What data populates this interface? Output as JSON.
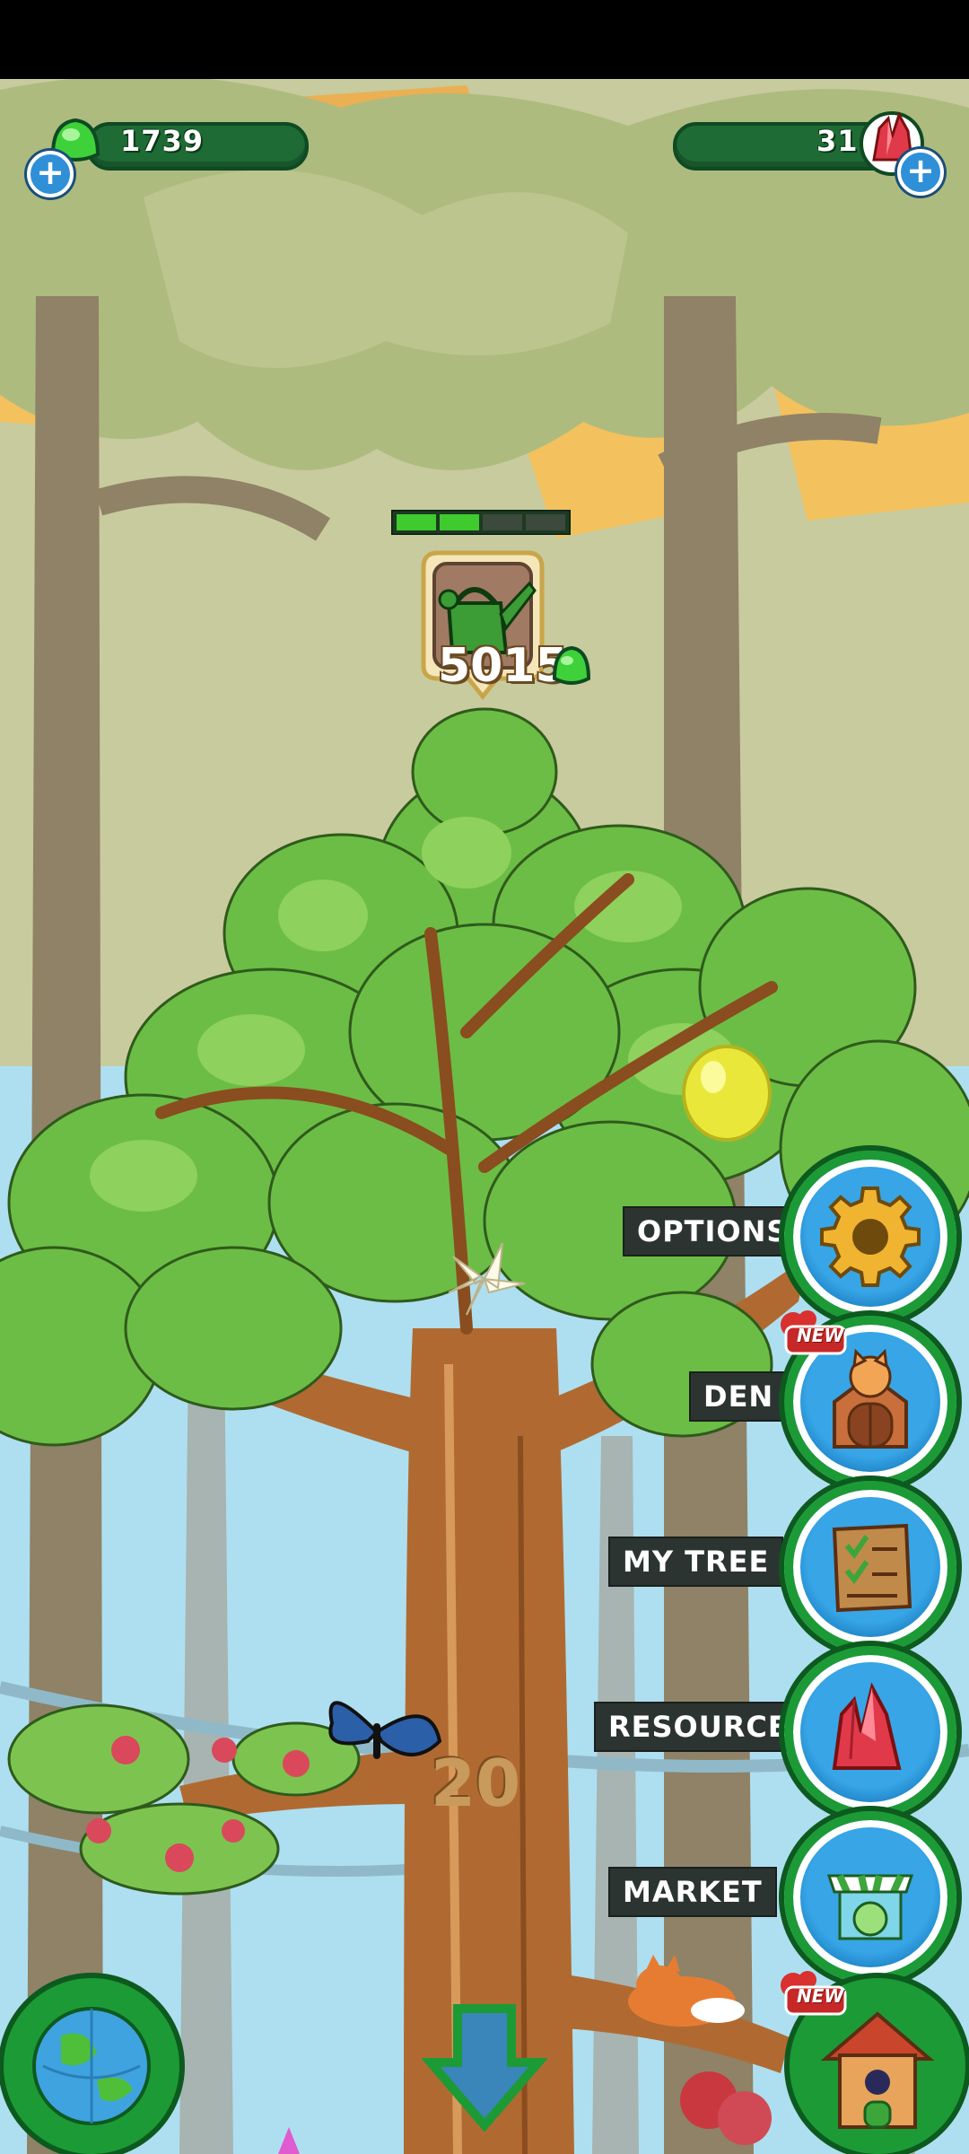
{
  "currencies": {
    "gems_green": "1739",
    "crystals_red": "31",
    "add_symbol": "+"
  },
  "watering": {
    "cost": "5015",
    "progress_segments_filled": 2,
    "progress_segments_total": 4
  },
  "tree": {
    "level": "20"
  },
  "menu": {
    "options": "OPTIONS",
    "den": "DEN",
    "my_tree": "MY TREE",
    "resources": "RESOURCES",
    "market": "MARKET",
    "new_badge": "NEW"
  },
  "icons": {
    "options": "gear-icon",
    "den": "cat-house-icon",
    "my_tree": "checklist-board-icon",
    "resources": "crystal-icon",
    "market": "shop-icon",
    "globe": "globe-icon",
    "home": "birdhouse-icon",
    "scroll": "down-arrow-icon"
  },
  "colors": {
    "sky": "#aedff0",
    "bark": "#b06a31",
    "leaf": "#6cbd45",
    "accent_green": "#1c9a36"
  }
}
